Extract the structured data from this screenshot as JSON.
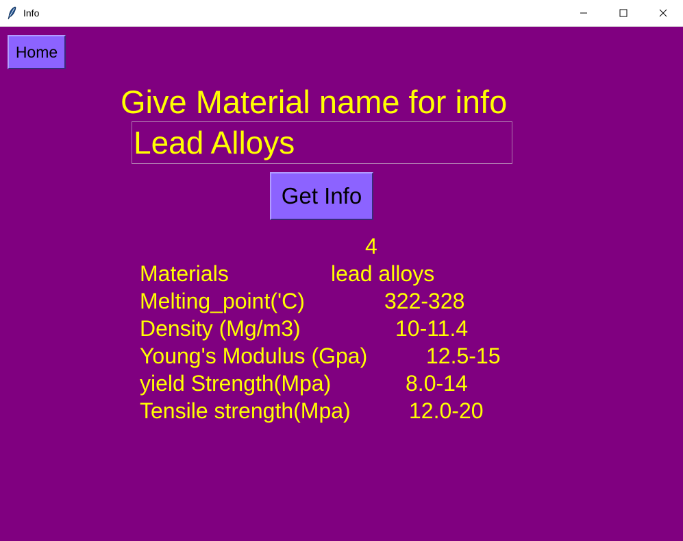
{
  "window": {
    "title": "Info",
    "controls": [
      "minimize",
      "maximize",
      "close"
    ]
  },
  "home_label": "Home",
  "heading": "Give Material name for info",
  "material_input": {
    "value": "Lead Alloys"
  },
  "get_info_label": "Get Info",
  "results": {
    "index": "4",
    "rows": [
      {
        "label": "Materials",
        "value": "lead alloys"
      },
      {
        "label": "Melting_point('C)",
        "value": "322-328"
      },
      {
        "label": "Density (Mg/m3)",
        "value": "10-11.4"
      },
      {
        "label": "Young's Modulus (Gpa)",
        "value": "12.5-15"
      },
      {
        "label": "yield Strength(Mpa)",
        "value": "8.0-14"
      },
      {
        "label": "Tensile strength(Mpa)",
        "value": "12.0-20"
      }
    ]
  },
  "colors": {
    "background": "#800080",
    "text": "#ffff00",
    "button": "#8c63ff"
  }
}
